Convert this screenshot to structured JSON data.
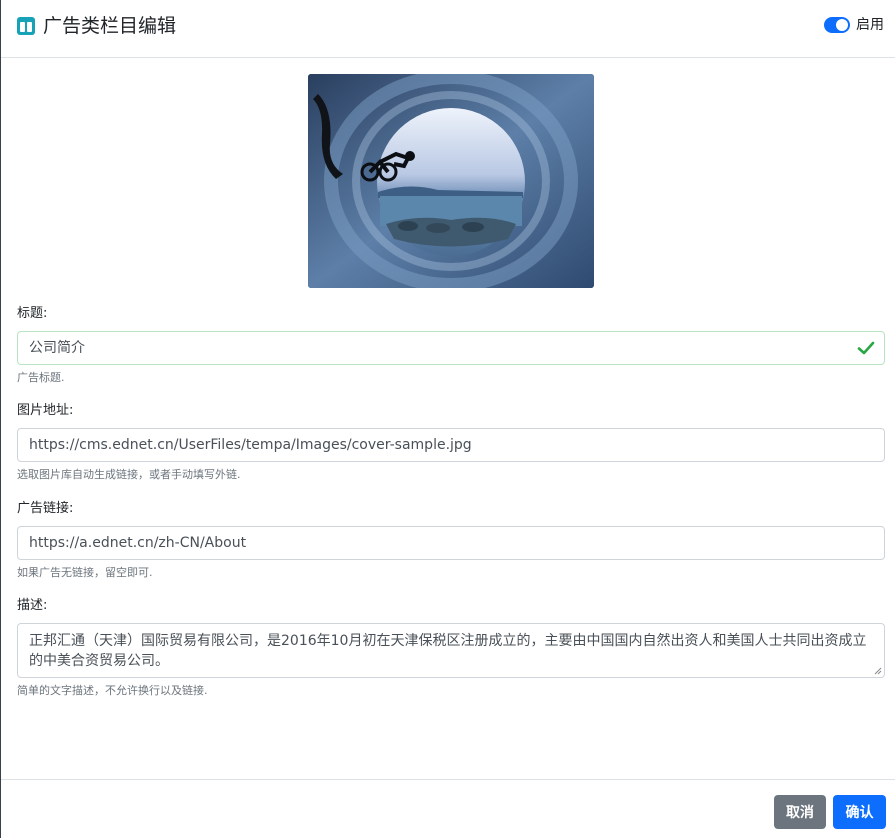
{
  "header": {
    "title": "广告类栏目编辑",
    "icon": "columns-icon",
    "enabled_label": "启用",
    "enabled": true,
    "accent": "#17a2b8",
    "toggle_color": "#0d6efd"
  },
  "cover_image": {
    "description_icon": "image-preview"
  },
  "form": {
    "title": {
      "label": "标题:",
      "value": "公司简介",
      "help": "广告标题.",
      "valid": true
    },
    "image_url": {
      "label": "图片地址:",
      "value": "https://cms.ednet.cn/UserFiles/tempa/Images/cover-sample.jpg",
      "help": "选取图片库自动生成链接，或者手动填写外链."
    },
    "ad_link": {
      "label": "广告链接:",
      "value": "https://a.ednet.cn/zh-CN/About",
      "help": "如果广告无链接，留空即可."
    },
    "description": {
      "label": "描述:",
      "value": "正邦汇通（天津）国际贸易有限公司，是2016年10月初在天津保税区注册成立的，主要由中国国内自然出资人和美国人士共同出资成立的中美合资贸易公司。",
      "help": "简单的文字描述，不允许换行以及链接."
    }
  },
  "footer": {
    "cancel_label": "取消",
    "confirm_label": "确认",
    "cancel_color": "#6c757d",
    "confirm_color": "#0d6efd"
  }
}
